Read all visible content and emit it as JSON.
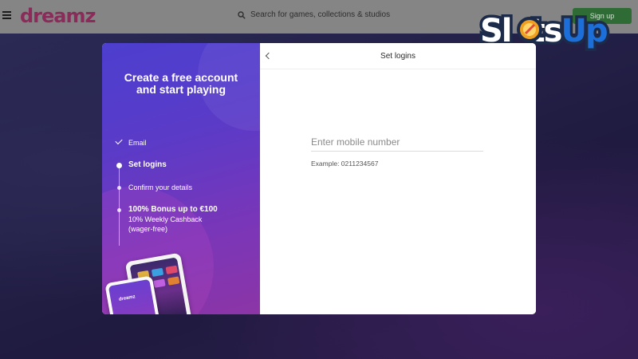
{
  "header": {
    "logo_text": "dreamz",
    "search_placeholder": "Search for games, collections & studios",
    "cta_label": "Sign up"
  },
  "brand_overlay": {
    "text": "SlotsUp"
  },
  "modal": {
    "promo": {
      "title": "Create a free account and start playing",
      "steps": [
        {
          "label": "Email",
          "state": "done"
        },
        {
          "label": "Set logins",
          "state": "current"
        },
        {
          "label": "Confirm your details",
          "state": "todo"
        },
        {
          "label": "100% Bonus up to €100",
          "sublabel": "10% Weekly Cashback (wager-free)",
          "state": "reward"
        }
      ],
      "phone_logo": "dreamz"
    },
    "form": {
      "title": "Set logins",
      "mobile_placeholder": "Enter mobile number",
      "mobile_value": "",
      "example": "Example: 0211234567"
    }
  },
  "colors": {
    "promo_gradient_start": "#4d3fcf",
    "promo_gradient_end": "#8c35a6",
    "topbar": "#858585",
    "cta": "#2f6b35",
    "brand_blue": "#1c6fd8",
    "brand_orange": "#f0a020"
  },
  "icons": {
    "menu": "menu-icon",
    "search": "search-icon",
    "back": "back-icon",
    "step_done": "check-icon"
  }
}
